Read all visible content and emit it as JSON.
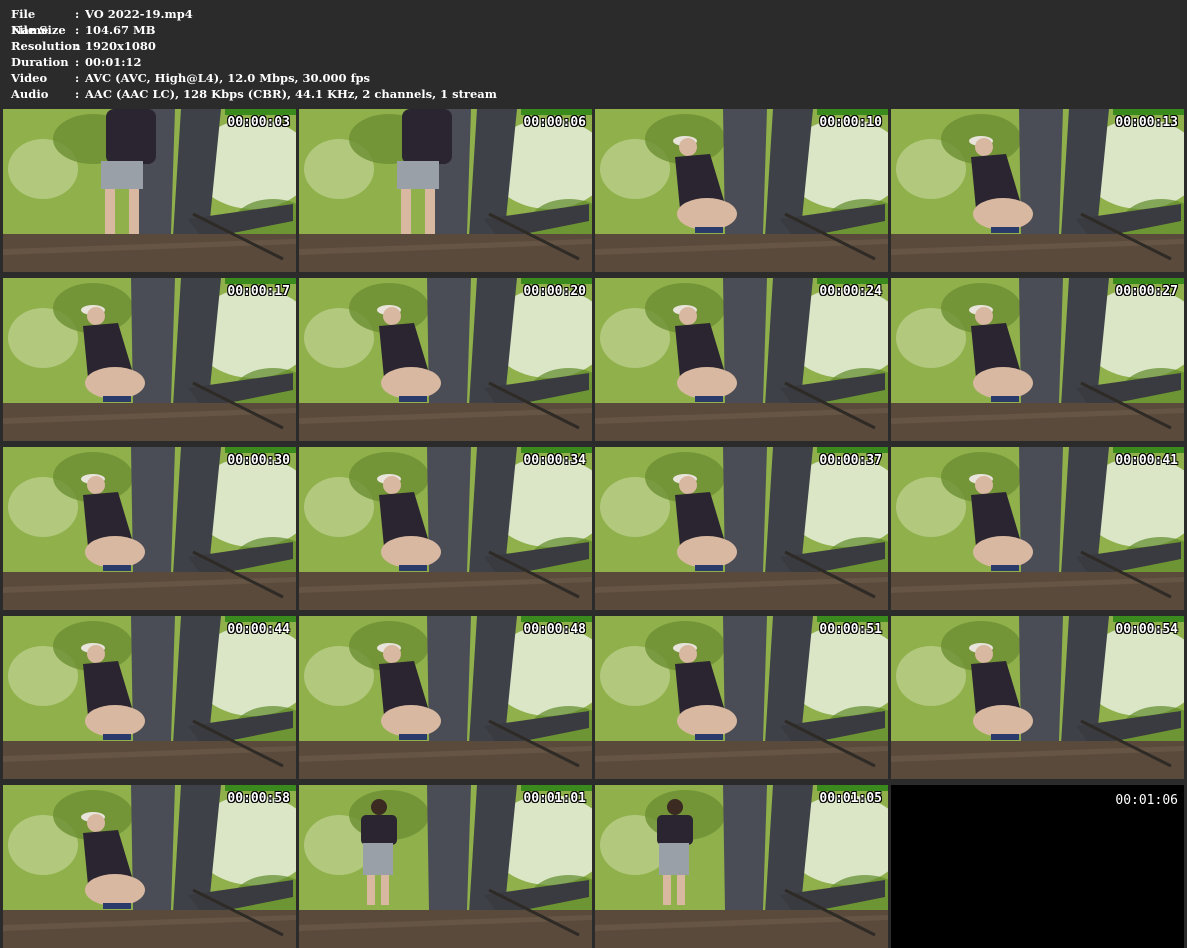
{
  "file_info": [
    {
      "key": "File Name",
      "value": "VO 2022-19.mp4"
    },
    {
      "key": "File Size",
      "value": "104.67 MB"
    },
    {
      "key": "Resolution",
      "value": "1920x1080"
    },
    {
      "key": "Duration",
      "value": "00:01:12"
    },
    {
      "key": "Video",
      "value": "AVC (AVC, High@L4), 12.0 Mbps, 30.000 fps"
    },
    {
      "key": "Audio",
      "value": "AAC (AAC LC), 128 Kbps (CBR), 44.1 KHz, 2 channels, 1 stream"
    }
  ],
  "separator": ":",
  "thumbnails": [
    {
      "time": "00:00:03",
      "pose": "standing-near"
    },
    {
      "time": "00:00:06",
      "pose": "standing-near"
    },
    {
      "time": "00:00:10",
      "pose": "squat"
    },
    {
      "time": "00:00:13",
      "pose": "squat"
    },
    {
      "time": "00:00:17",
      "pose": "squat"
    },
    {
      "time": "00:00:20",
      "pose": "squat"
    },
    {
      "time": "00:00:24",
      "pose": "squat"
    },
    {
      "time": "00:00:27",
      "pose": "squat"
    },
    {
      "time": "00:00:30",
      "pose": "squat"
    },
    {
      "time": "00:00:34",
      "pose": "squat"
    },
    {
      "time": "00:00:37",
      "pose": "squat"
    },
    {
      "time": "00:00:41",
      "pose": "squat"
    },
    {
      "time": "00:00:44",
      "pose": "squat"
    },
    {
      "time": "00:00:48",
      "pose": "squat"
    },
    {
      "time": "00:00:51",
      "pose": "squat"
    },
    {
      "time": "00:00:54",
      "pose": "squat"
    },
    {
      "time": "00:00:58",
      "pose": "squat"
    },
    {
      "time": "00:01:01",
      "pose": "standing-far"
    },
    {
      "time": "00:01:05",
      "pose": "standing-far"
    },
    {
      "time": "00:01:06",
      "pose": "blank"
    }
  ],
  "colors": {
    "background": "#2b2b2b",
    "foliage": "#8fb04a",
    "sky": "#e8f0dc",
    "trunk": "#4a4d55",
    "ground": "#5a4a3c",
    "shirt": "#2a2530",
    "shorts": "#9aa0a8",
    "skin": "#d8b8a0"
  }
}
